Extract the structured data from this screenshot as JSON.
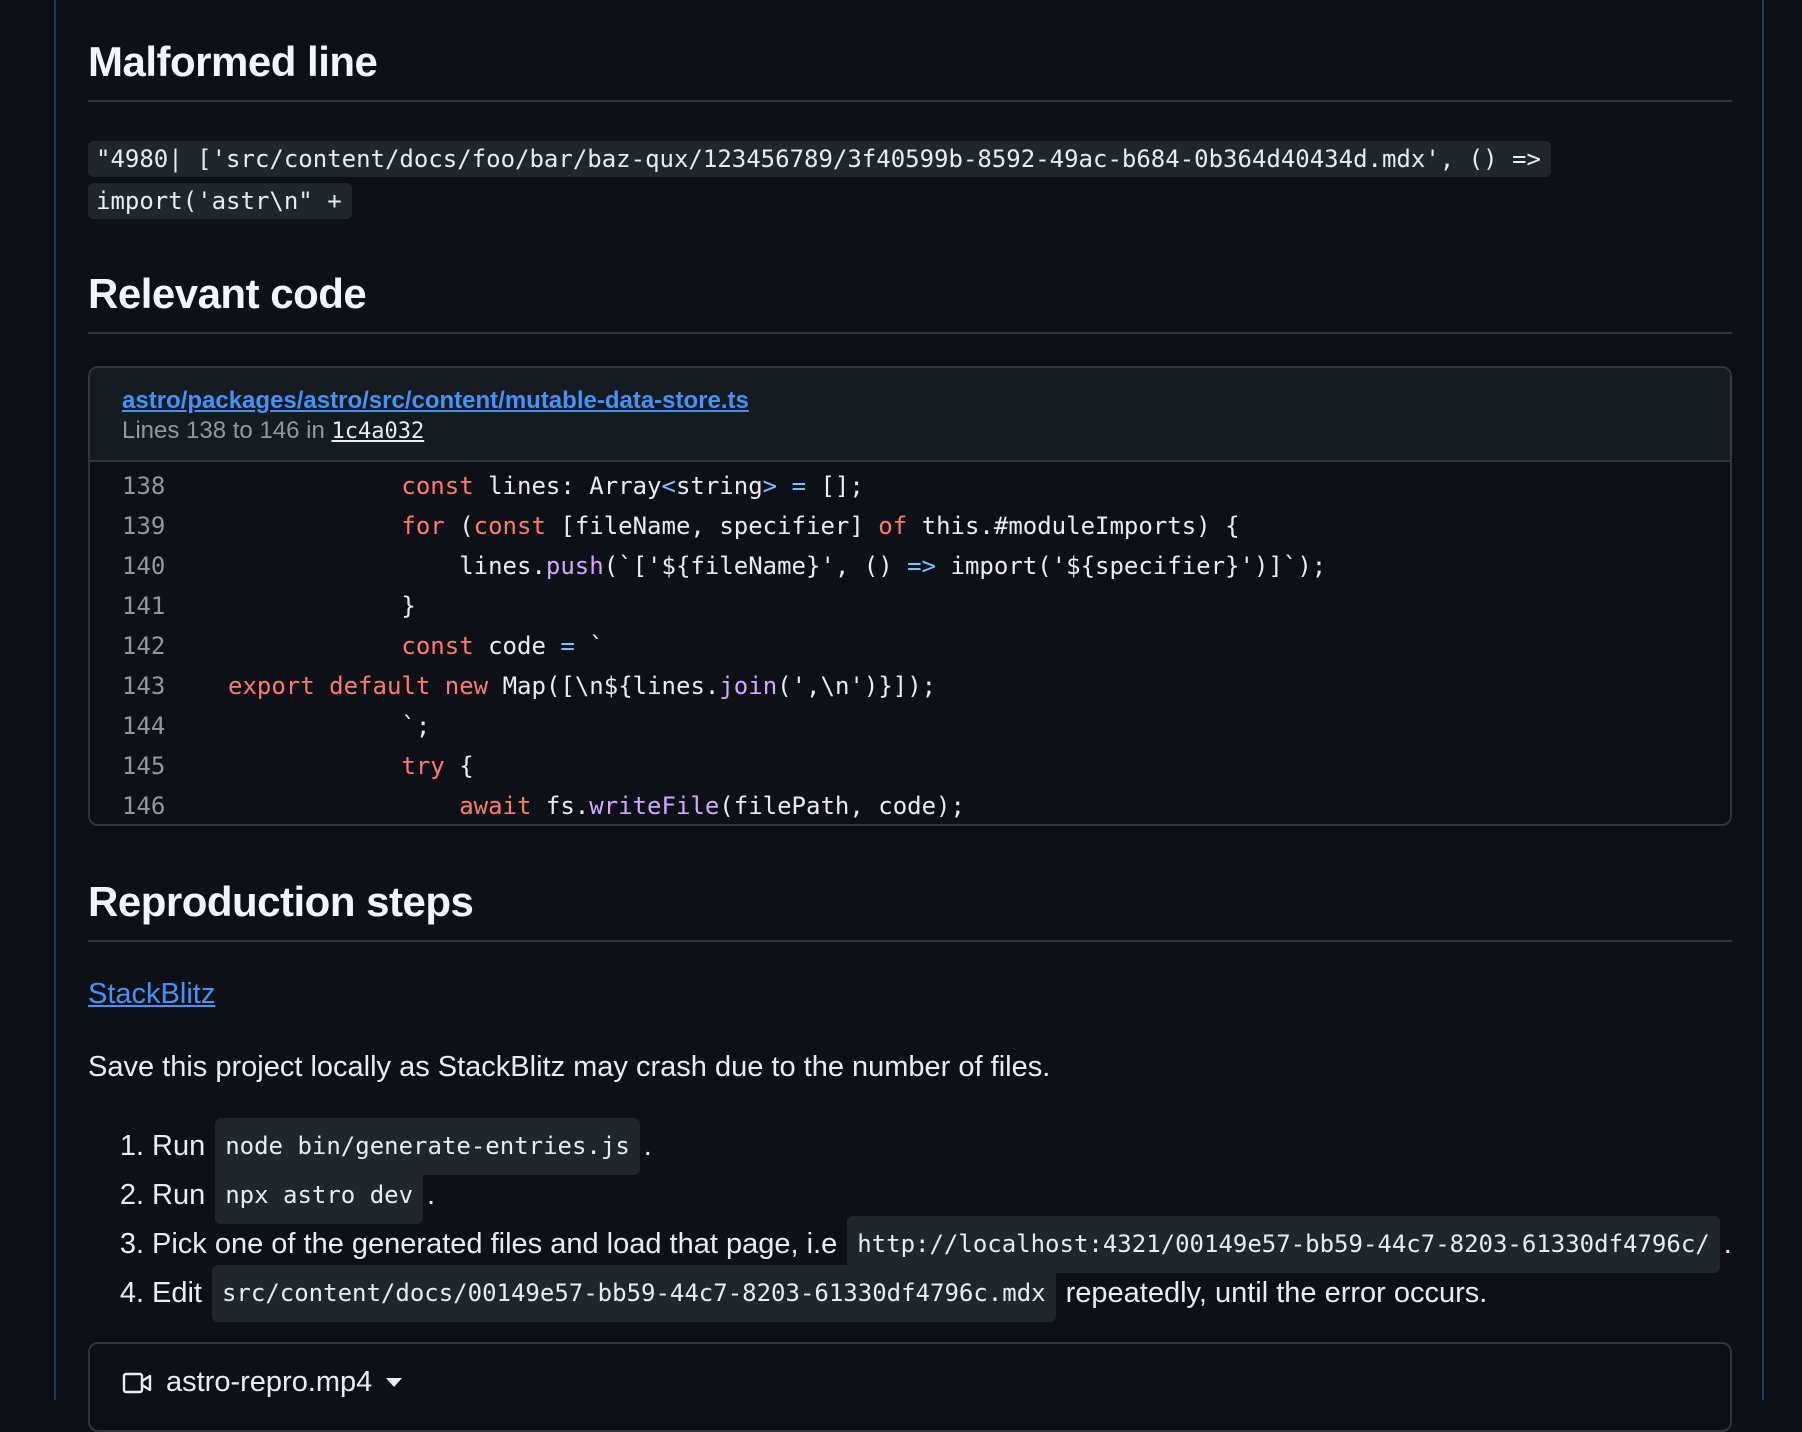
{
  "sections": {
    "malformed_title": "Malformed line",
    "relevant_title": "Relevant code",
    "repro_title": "Reproduction steps"
  },
  "malformed_line": "\"4980|  ['src/content/docs/foo/bar/baz-qux/123456789/3f40599b-8592-49ac-b684-0b364d40434d.mdx', () => import('astr\\n\" +",
  "code_snippet": {
    "file_link": "astro/packages/astro/src/content/mutable-data-store.ts",
    "lines_prefix": "Lines 138 to 146 in",
    "commit": "1c4a032",
    "lines": [
      {
        "n": "138",
        "t": "\t\t\tconst lines: Array<string> = [];"
      },
      {
        "n": "139",
        "t": "\t\t\tfor (const [fileName, specifier] of this.#moduleImports) {"
      },
      {
        "n": "140",
        "t": "\t\t\t\tlines.push(`['${fileName}', () => import('${specifier}')]`);"
      },
      {
        "n": "141",
        "t": "\t\t\t}"
      },
      {
        "n": "142",
        "t": "\t\t\tconst code = `"
      },
      {
        "n": "143",
        "t": "export default new Map([\\n${lines.join(',\\n')}]);"
      },
      {
        "n": "144",
        "t": "\t\t\t`;"
      },
      {
        "n": "145",
        "t": "\t\t\ttry {"
      },
      {
        "n": "146",
        "t": "\t\t\t\tawait fs.writeFile(filePath, code);"
      }
    ]
  },
  "stackblitz_link": "StackBlitz",
  "save_text": "Save this project locally as StackBlitz may crash due to the number of files.",
  "steps": [
    {
      "num": "1.",
      "pre": "Run",
      "code": "node bin/generate-entries.js",
      "post": "."
    },
    {
      "num": "2.",
      "pre": "Run",
      "code": "npx astro dev",
      "post": "."
    },
    {
      "num": "3.",
      "pre": "Pick one of the generated files and load that page, i.e",
      "code": "http://localhost:4321/00149e57-bb59-44c7-8203-61330df4796c/",
      "post": "."
    },
    {
      "num": "4.",
      "pre": "Edit",
      "code": "src/content/docs/00149e57-bb59-44c7-8203-61330df4796c.mdx",
      "post": "repeatedly, until the error occurs."
    }
  ],
  "attachment": {
    "filename": "astro-repro.mp4",
    "icon": "video-camera-icon"
  }
}
